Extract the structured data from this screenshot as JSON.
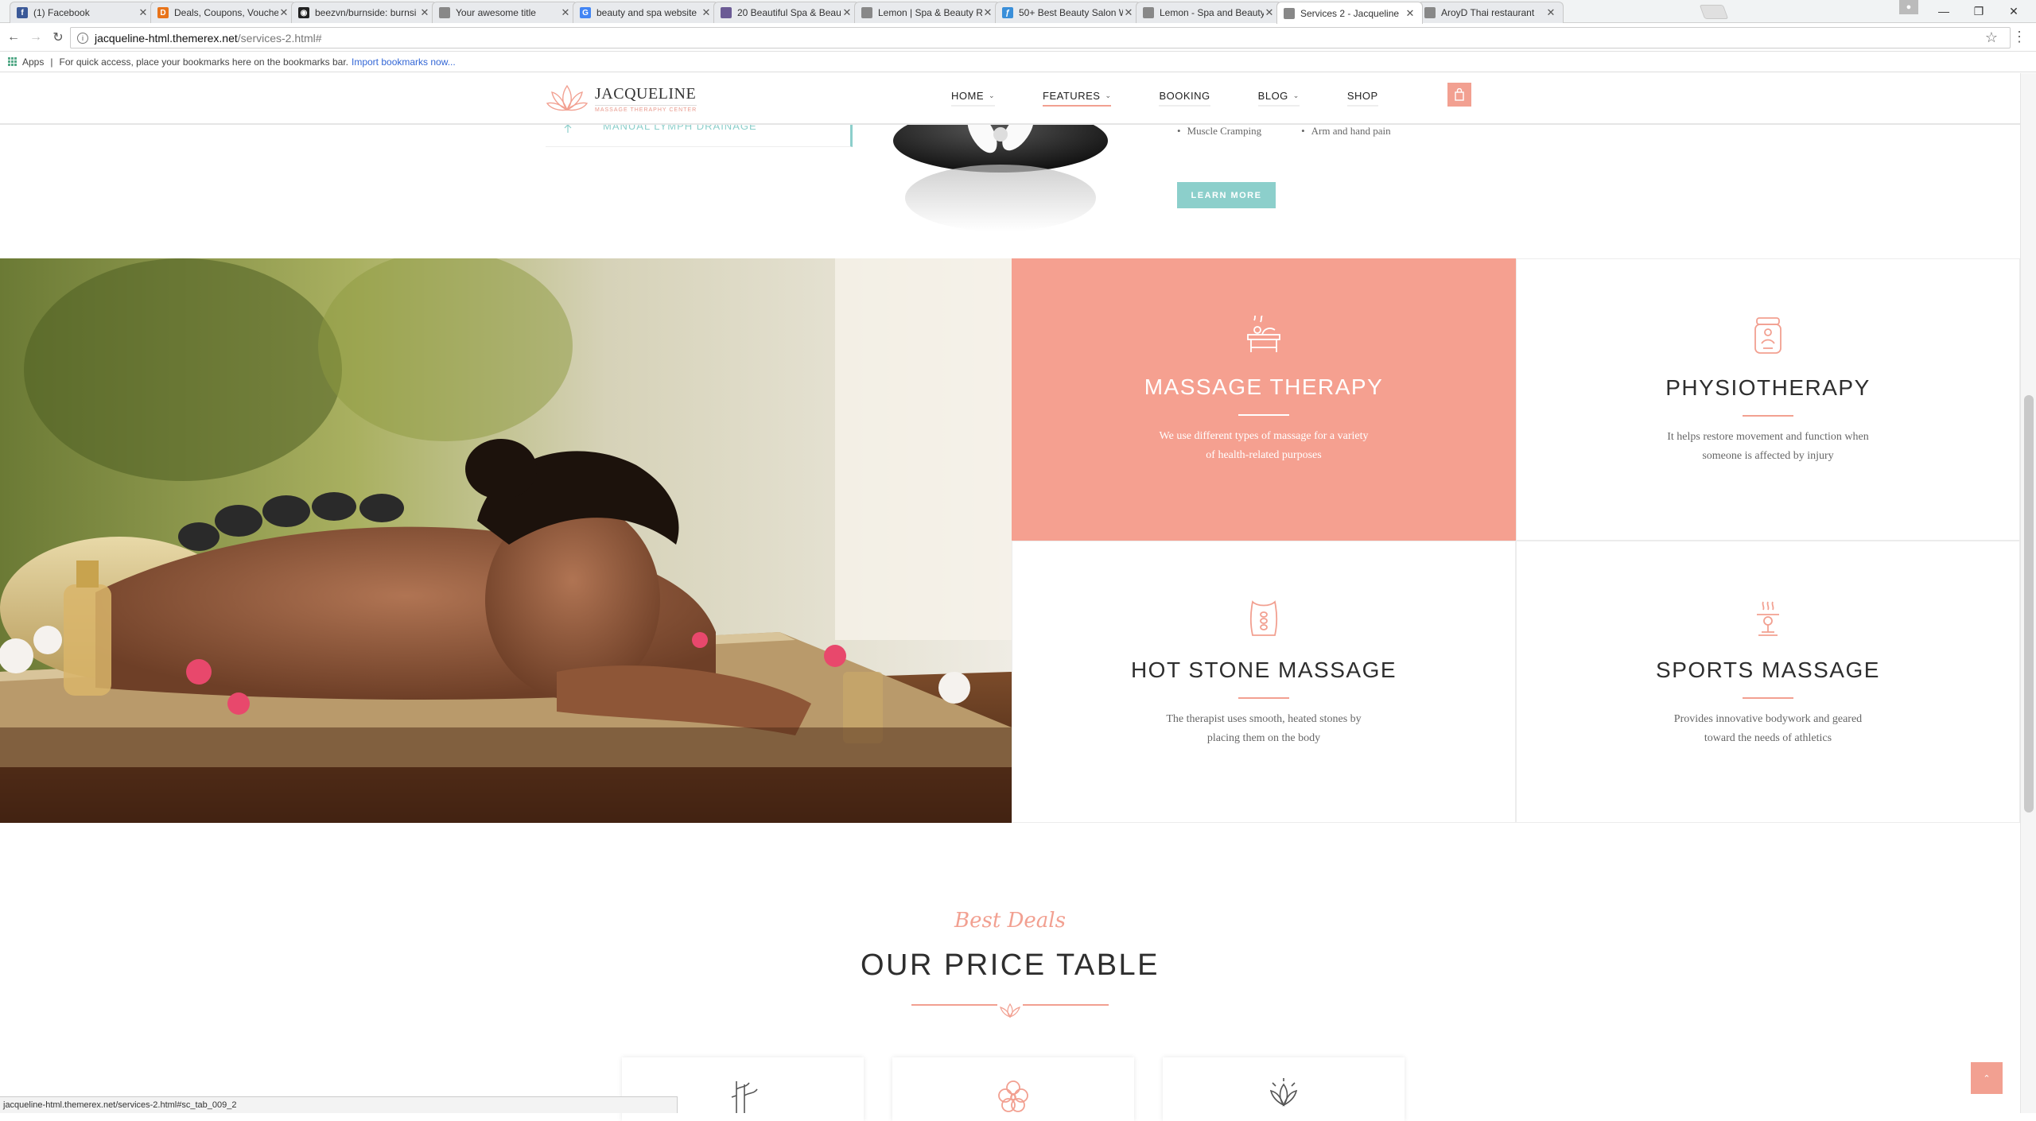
{
  "browser": {
    "tabs": [
      {
        "title": "(1) Facebook",
        "icon": "facebook-icon",
        "color": "#3b5998",
        "glyph": "f"
      },
      {
        "title": "Deals, Coupons, Voucher",
        "icon": "deals-icon",
        "color": "#e8741a",
        "glyph": "D"
      },
      {
        "title": "beezvn/burnside: burnsi",
        "icon": "github-icon",
        "color": "#222222",
        "glyph": "◉"
      },
      {
        "title": "Your awesome title",
        "icon": "page-icon",
        "color": "#888888",
        "glyph": ""
      },
      {
        "title": "beauty and spa website",
        "icon": "google-icon",
        "color": "#4285f4",
        "glyph": "G"
      },
      {
        "title": "20 Beautiful Spa & Beau",
        "icon": "site-icon",
        "color": "#6b5b95",
        "glyph": ""
      },
      {
        "title": "Lemon | Spa & Beauty Re",
        "icon": "page-icon",
        "color": "#888888",
        "glyph": ""
      },
      {
        "title": "50+ Best Beauty Salon W",
        "icon": "site-icon",
        "color": "#3a8fd9",
        "glyph": "ƒ"
      },
      {
        "title": "Lemon - Spa and Beauty",
        "icon": "page-icon",
        "color": "#888888",
        "glyph": ""
      },
      {
        "title": "Services 2 - Jacqueline",
        "icon": "page-icon",
        "color": "#888888",
        "glyph": "",
        "active": true
      },
      {
        "title": "AroyD Thai restaurant",
        "icon": "page-icon",
        "color": "#888888",
        "glyph": ""
      }
    ],
    "url_host": "jacqueline-html.themerex.net",
    "url_path": "/services-2.html#",
    "bookmarks": {
      "apps_label": "Apps",
      "hint": "For quick access, place your bookmarks here on the bookmarks bar.",
      "import_link": "Import bookmarks now..."
    },
    "status_url": "jacqueline-html.themerex.net/services-2.html#sc_tab_009_2"
  },
  "site": {
    "logo": {
      "name": "JACQUELINE",
      "tagline": "MASSAGE THERAPHY CENTER"
    },
    "nav": [
      {
        "label": "HOME",
        "dropdown": true
      },
      {
        "label": "FEATURES",
        "dropdown": true,
        "current": true
      },
      {
        "label": "BOOKING",
        "dropdown": false
      },
      {
        "label": "BLOG",
        "dropdown": true
      },
      {
        "label": "SHOP",
        "dropdown": false
      }
    ],
    "upper": {
      "partial_tab_label": "MANUAL LYMPH DRAINAGE",
      "bullets": [
        "Muscle Cramping",
        "Arm and hand pain"
      ],
      "learn_more": "LEARN MORE"
    },
    "services": [
      {
        "title": "MASSAGE THERAPY",
        "desc": "We use different types of massage for a variety of health-related purposes",
        "icon": "massage-table-icon"
      },
      {
        "title": "PHYSIOTHERAPY",
        "desc": "It helps restore movement and function when someone is affected by injury",
        "icon": "physio-icon"
      },
      {
        "title": "HOT STONE MASSAGE",
        "desc": "The therapist uses smooth, heated stones by placing them on the body",
        "icon": "hot-stone-icon"
      },
      {
        "title": "SPORTS MASSAGE",
        "desc": "Provides innovative bodywork and geared toward the needs of athletics",
        "icon": "sports-massage-icon"
      }
    ],
    "price": {
      "script": "Best Deals",
      "title": "OUR PRICE TABLE",
      "cards": [
        {
          "icon": "bamboo-icon"
        },
        {
          "icon": "flower-icon"
        },
        {
          "icon": "lotus-icon"
        }
      ]
    },
    "colors": {
      "accent": "#f2a091",
      "teal": "#8ccfcb",
      "text": "#2e2e2e"
    }
  }
}
